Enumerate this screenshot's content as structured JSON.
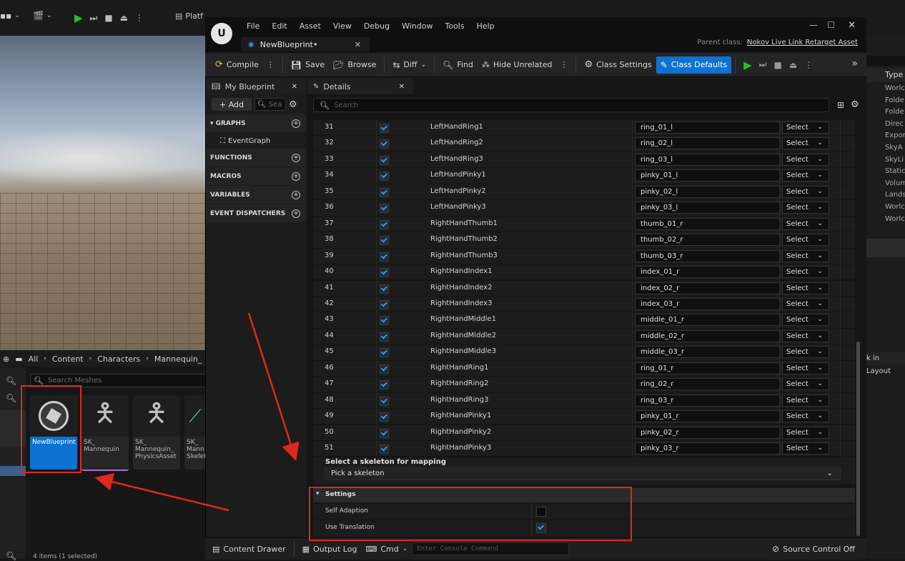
{
  "bg_editor": {
    "platform_label": "Platf",
    "content_path": [
      "All",
      "Content",
      "Characters",
      "Mannequin_"
    ],
    "search_placeholder": "Search Meshes",
    "assets": [
      {
        "label": "NewBlueprint",
        "selected": true
      },
      {
        "label": "SK_ Mannequin"
      },
      {
        "label": "SK_ Mannequin_ PhysicsAsset"
      },
      {
        "label": "SK_ Mann Skelet"
      }
    ],
    "items_count": "4 items (1 selected)",
    "outliner_header": "Type",
    "outliner_items": [
      "Worlc",
      "Folde",
      "Folde",
      "Direc",
      "Expor",
      "SkyA",
      "SkyLi",
      "Static",
      "Volum",
      "Lands",
      "Worlc",
      "Worlc"
    ],
    "layout_label": "k in Layout"
  },
  "window": {
    "menu": [
      "File",
      "Edit",
      "Asset",
      "View",
      "Debug",
      "Window",
      "Tools",
      "Help"
    ],
    "tab_title": "NewBlueprint•",
    "parent_class_label": "Parent class:",
    "parent_class_value": "Nokov Live Link Retarget Asset"
  },
  "toolbar": {
    "compile": "Compile",
    "save": "Save",
    "browse": "Browse",
    "diff": "Diff",
    "find": "Find",
    "hide_unrelated": "Hide Unrelated",
    "class_settings": "Class Settings",
    "class_defaults": "Class Defaults"
  },
  "my_blueprint": {
    "tab": "My Blueprint",
    "add": "+ Add",
    "search": "Sea",
    "graphs": "GRAPHS",
    "event_graph": "EventGraph",
    "functions": "FUNCTIONS",
    "macros": "MACROS",
    "variables": "VARIABLES",
    "event_dispatchers": "EVENT DISPATCHERS"
  },
  "details": {
    "tab": "Details",
    "search_placeholder": "Search",
    "rows": [
      {
        "idx": "31",
        "name": "LeftHandRing1",
        "bone": "ring_01_l"
      },
      {
        "idx": "32",
        "name": "LeftHandRing2",
        "bone": "ring_02_l"
      },
      {
        "idx": "33",
        "name": "LeftHandRing3",
        "bone": "ring_03_l"
      },
      {
        "idx": "34",
        "name": "LeftHandPinky1",
        "bone": "pinky_01_l"
      },
      {
        "idx": "35",
        "name": "LeftHandPinky2",
        "bone": "pinky_02_l"
      },
      {
        "idx": "36",
        "name": "LeftHandPinky3",
        "bone": "pinky_03_l"
      },
      {
        "idx": "37",
        "name": "RightHandThumb1",
        "bone": "thumb_01_r"
      },
      {
        "idx": "38",
        "name": "RightHandThumb2",
        "bone": "thumb_02_r"
      },
      {
        "idx": "39",
        "name": "RightHandThumb3",
        "bone": "thumb_03_r"
      },
      {
        "idx": "40",
        "name": "RightHandIndex1",
        "bone": "index_01_r"
      },
      {
        "idx": "41",
        "name": "RightHandIndex2",
        "bone": "index_02_r"
      },
      {
        "idx": "42",
        "name": "RightHandIndex3",
        "bone": "index_03_r"
      },
      {
        "idx": "43",
        "name": "RightHandMiddle1",
        "bone": "middle_01_r"
      },
      {
        "idx": "44",
        "name": "RightHandMiddle2",
        "bone": "middle_02_r"
      },
      {
        "idx": "45",
        "name": "RightHandMiddle3",
        "bone": "middle_03_r"
      },
      {
        "idx": "46",
        "name": "RightHandRing1",
        "bone": "ring_01_r"
      },
      {
        "idx": "47",
        "name": "RightHandRing2",
        "bone": "ring_02_r"
      },
      {
        "idx": "48",
        "name": "RightHandRing3",
        "bone": "ring_03_r"
      },
      {
        "idx": "49",
        "name": "RightHandPinky1",
        "bone": "pinky_01_r"
      },
      {
        "idx": "50",
        "name": "RightHandPinky2",
        "bone": "pinky_02_r"
      },
      {
        "idx": "51",
        "name": "RightHandPinky3",
        "bone": "pinky_03_r"
      }
    ],
    "select_label": "Select",
    "skeleton_mapping_label": "Select a skeleton for mapping",
    "skeleton_dropdown": "Pick a skeleton",
    "settings_header": "Settings",
    "self_adaption": "Self Adaption",
    "self_adaption_checked": false,
    "use_translation": "Use Translation",
    "use_translation_checked": true
  },
  "statusbar": {
    "content_drawer": "Content Drawer",
    "output_log": "Output Log",
    "cmd": "Cmd",
    "console_placeholder": "Enter Console Command",
    "source_control": "Source Control Off"
  },
  "colors": {
    "accent_blue": "#0e72d2",
    "highlight_red": "#e0281f",
    "play_green": "#25c124"
  }
}
